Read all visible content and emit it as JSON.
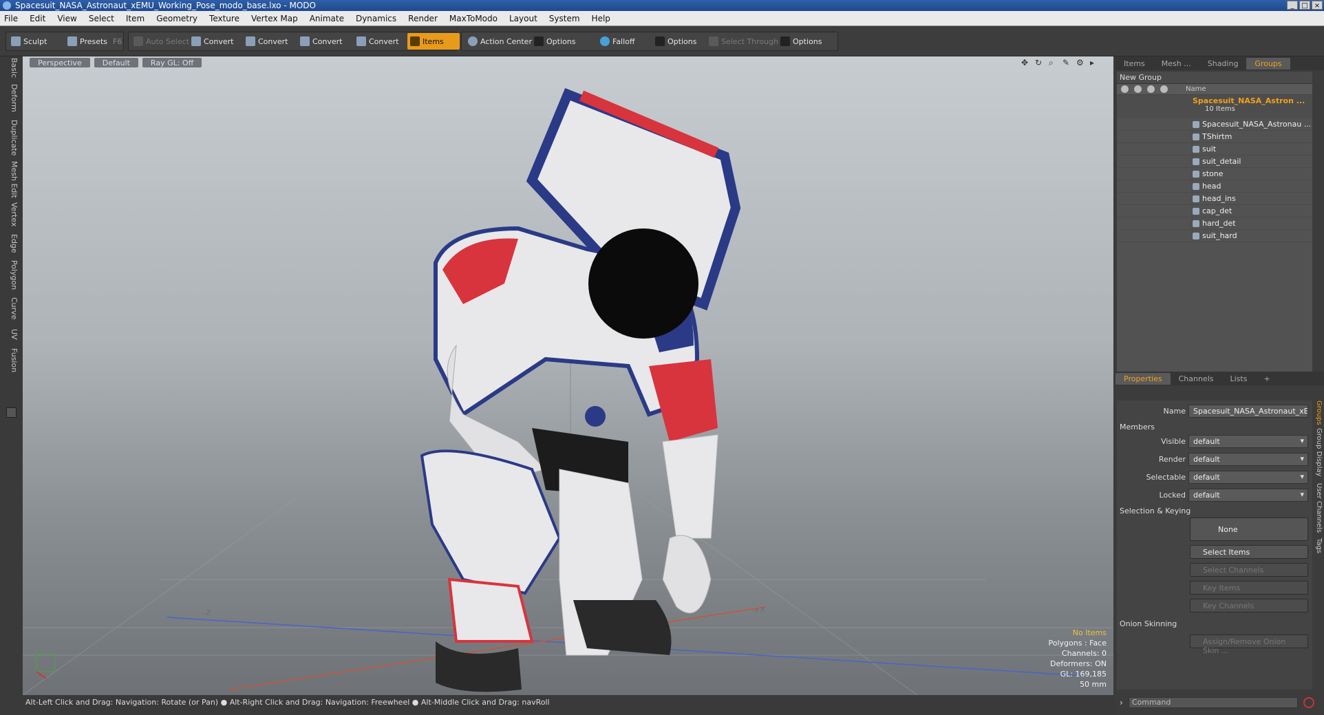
{
  "window": {
    "title": "Spacesuit_NASA_Astronaut_xEMU_Working_Pose_modo_base.lxo - MODO",
    "controls": [
      "_",
      "□",
      "×"
    ]
  },
  "menu": [
    "File",
    "Edit",
    "View",
    "Select",
    "Item",
    "Geometry",
    "Texture",
    "Vertex Map",
    "Animate",
    "Dynamics",
    "Render",
    "MaxToModo",
    "Layout",
    "System",
    "Help"
  ],
  "toolbar": {
    "sculpt": "Sculpt",
    "presets": "Presets",
    "presets_key": "F6",
    "auto_select": "Auto Select",
    "convert1": "Convert",
    "convert2": "Convert",
    "convert3": "Convert",
    "convert4": "Convert",
    "items": "Items",
    "action_center": "Action Center",
    "options1": "Options",
    "falloff": "Falloff",
    "options2": "Options",
    "select_through": "Select Through",
    "options3": "Options"
  },
  "left_tabs": [
    "Basic",
    "Deform",
    "Duplicate",
    "Mesh Edit",
    "Vertex",
    "Edge",
    "Polygon",
    "Curve",
    "UV",
    "Fusion"
  ],
  "viewport": {
    "view": "Perspective",
    "shading": "Default",
    "raygl": "Ray GL: Off",
    "axis_neg_z": "-Z",
    "axis_pos_x": "+X",
    "hud": {
      "selection": "No Items",
      "polygons": "Polygons : Face",
      "channels": "Channels: 0",
      "deformers": "Deformers: ON",
      "gl": "GL: 169,185",
      "scale": "50 mm"
    },
    "colors": {
      "suit_white": "#e8e8ea",
      "suit_red": "#d8343e",
      "suit_blue": "#2b3a86",
      "visor": "#0b0b0b",
      "boots": "#2a2a2a"
    }
  },
  "status": "Alt-Left Click and Drag: Navigation: Rotate (or Pan) ● Alt-Right Click and Drag: Navigation: Freewheel ● Alt-Middle Click and Drag: navRoll",
  "groups_panel": {
    "tabs": [
      "Items",
      "Mesh ...",
      "Shading",
      "Groups"
    ],
    "new_group": "New Group",
    "col_name": "Name",
    "group_name": "Spacesuit_NASA_Astron ...",
    "group_count": "10 Items",
    "children": [
      "Spacesuit_NASA_Astronau ...",
      "TShirtm",
      "suit",
      "suit_detail",
      "stone",
      "head",
      "head_ins",
      "cap_det",
      "hard_det",
      "suit_hard"
    ]
  },
  "properties": {
    "tabs": [
      "Properties",
      "Channels",
      "Lists",
      "+"
    ],
    "name_label": "Name",
    "name_value": "Spacesuit_NASA_Astronaut_xEMU",
    "members": "Members",
    "visible_label": "Visible",
    "visible": "default",
    "render_label": "Render",
    "render": "default",
    "selectable_label": "Selectable",
    "selectable": "default",
    "locked_label": "Locked",
    "locked": "default",
    "sel_keying": "Selection & Keying",
    "none": "None",
    "select_items": "Select Items",
    "select_channels": "Select Channels",
    "key_items": "Key Items",
    "key_channels": "Key Channels",
    "onion": "Onion Skinning",
    "onion_btn": "Assign/Remove Onion Skin ...",
    "side_tabs": [
      "Groups",
      "Group Display",
      "User Channels",
      "Tags"
    ]
  },
  "command": {
    "placeholder": "Command"
  }
}
